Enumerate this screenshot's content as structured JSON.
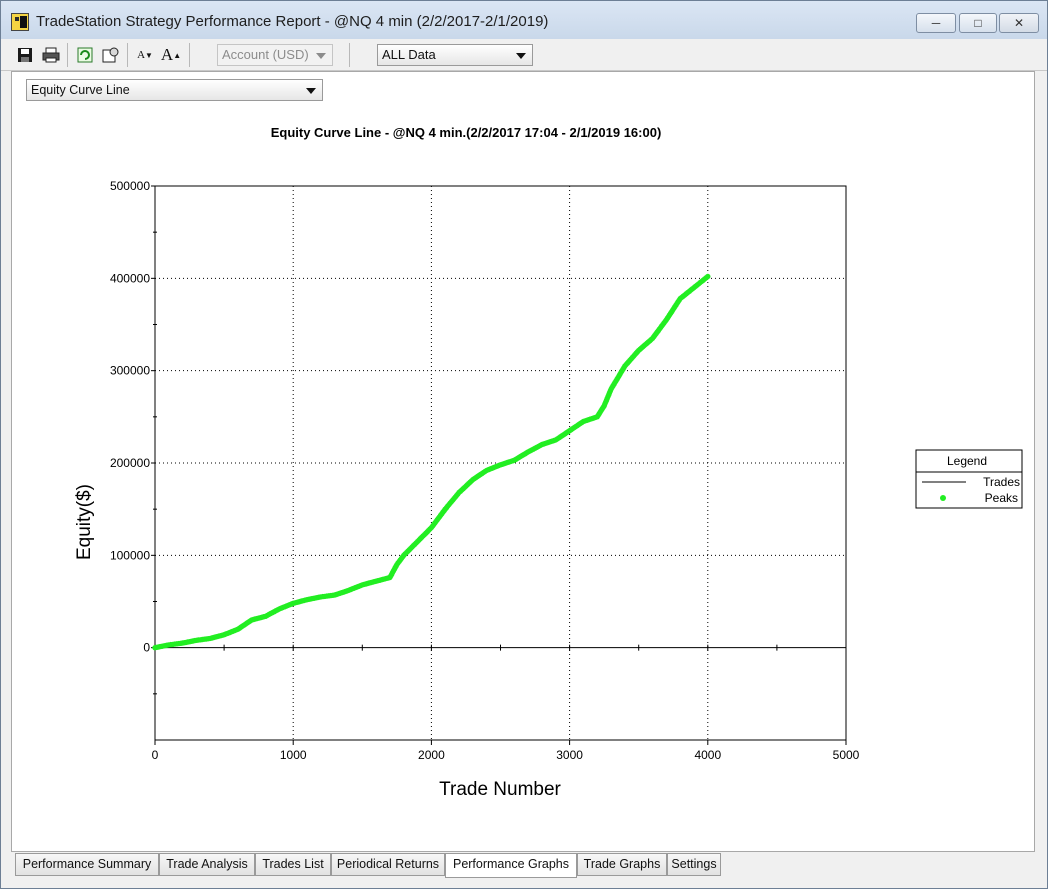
{
  "window": {
    "title": "TradeStation Strategy Performance Report - @NQ 4 min (2/2/2017-2/1/2019)"
  },
  "toolbar": {
    "account_combo": "Account (USD)",
    "data_combo": "ALL Data",
    "font_smaller_label": "A",
    "font_larger_label": "A"
  },
  "graph_selector": "Equity Curve Line",
  "tabs": [
    {
      "label": "Performance Summary"
    },
    {
      "label": "Trade Analysis"
    },
    {
      "label": "Trades List"
    },
    {
      "label": "Periodical Returns"
    },
    {
      "label": "Performance Graphs"
    },
    {
      "label": "Trade Graphs"
    },
    {
      "label": "Settings"
    }
  ],
  "colors": {
    "peaks": "#22ee22",
    "trades": "#000000"
  },
  "chart_data": {
    "type": "line",
    "title": "Equity Curve Line - @NQ 4 min.(2/2/2017 17:04 - 2/1/2019 16:00)",
    "xlabel": "Trade Number",
    "ylabel": "Equity($)",
    "xlim": [
      0,
      5000
    ],
    "ylim": [
      -100000,
      500000
    ],
    "x_ticks": [
      "0",
      "1000",
      "2000",
      "3000",
      "4000",
      "5000"
    ],
    "y_ticks": [
      "0",
      "100000",
      "200000",
      "300000",
      "400000",
      "500000"
    ],
    "grid": true,
    "legend": {
      "title": "Legend",
      "placement": "right"
    },
    "series": [
      {
        "name": "Trades",
        "x": [
          0,
          100,
          200,
          300,
          400,
          500,
          600,
          700,
          800,
          900,
          1000,
          1100,
          1200,
          1300,
          1400,
          1500,
          1600,
          1700,
          1750,
          1800,
          1900,
          2000,
          2100,
          2200,
          2300,
          2400,
          2500,
          2600,
          2700,
          2800,
          2900,
          3000,
          3100,
          3200,
          3250,
          3300,
          3400,
          3500,
          3600,
          3700,
          3800,
          3900,
          4000
        ],
        "values": [
          0,
          3000,
          5000,
          8000,
          10000,
          14000,
          20000,
          30000,
          34000,
          42000,
          48000,
          52000,
          55000,
          57000,
          62000,
          68000,
          72000,
          76000,
          90000,
          100000,
          115000,
          130000,
          150000,
          168000,
          182000,
          192000,
          198000,
          203000,
          212000,
          220000,
          225000,
          235000,
          245000,
          250000,
          262000,
          280000,
          305000,
          322000,
          335000,
          355000,
          378000,
          390000,
          402000
        ]
      },
      {
        "name": "Peaks",
        "x": [
          0,
          100,
          200,
          300,
          400,
          500,
          600,
          700,
          800,
          900,
          1000,
          1100,
          1200,
          1300,
          1400,
          1500,
          1600,
          1700,
          1750,
          1800,
          1900,
          2000,
          2100,
          2200,
          2300,
          2400,
          2500,
          2600,
          2700,
          2800,
          2900,
          3000,
          3100,
          3200,
          3250,
          3300,
          3400,
          3500,
          3600,
          3700,
          3800,
          3900,
          4000
        ],
        "values": [
          0,
          3000,
          5000,
          8000,
          10000,
          14000,
          20000,
          30000,
          34000,
          42000,
          48000,
          52000,
          55000,
          57000,
          62000,
          68000,
          72000,
          76000,
          90000,
          100000,
          115000,
          130000,
          150000,
          168000,
          182000,
          192000,
          198000,
          203000,
          212000,
          220000,
          225000,
          235000,
          245000,
          250000,
          262000,
          280000,
          305000,
          322000,
          335000,
          355000,
          378000,
          390000,
          402000
        ]
      }
    ]
  }
}
